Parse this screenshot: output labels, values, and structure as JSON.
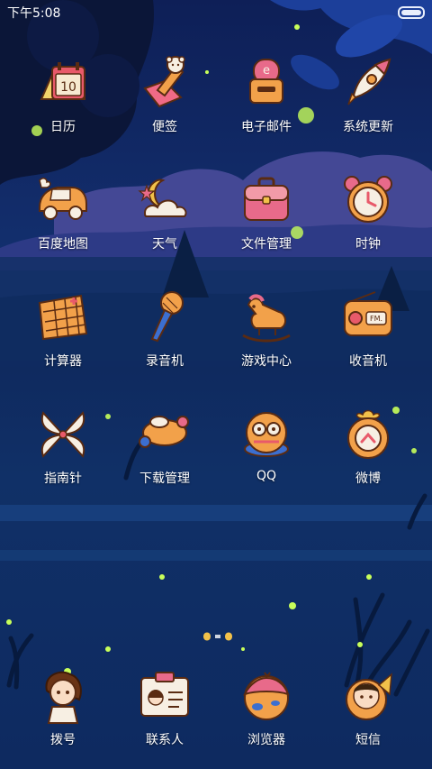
{
  "status_bar": {
    "time": "下午5:08"
  },
  "apps": [
    {
      "label": "日历",
      "icon": "calendar-icon",
      "text": "10"
    },
    {
      "label": "便签",
      "icon": "notes-icon"
    },
    {
      "label": "电子邮件",
      "icon": "mailbox-icon",
      "text": "e"
    },
    {
      "label": "系统更新",
      "icon": "rocket-icon"
    },
    {
      "label": "百度地图",
      "icon": "car-icon"
    },
    {
      "label": "天气",
      "icon": "weather-icon"
    },
    {
      "label": "文件管理",
      "icon": "briefcase-icon"
    },
    {
      "label": "时钟",
      "icon": "alarm-clock-icon"
    },
    {
      "label": "计算器",
      "icon": "calculator-icon"
    },
    {
      "label": "录音机",
      "icon": "microphone-icon"
    },
    {
      "label": "游戏中心",
      "icon": "rocking-horse-icon"
    },
    {
      "label": "收音机",
      "icon": "radio-icon",
      "text": "FM."
    },
    {
      "label": "指南针",
      "icon": "compass-icon"
    },
    {
      "label": "下载管理",
      "icon": "download-icon"
    },
    {
      "label": "QQ",
      "icon": "qq-icon"
    },
    {
      "label": "微博",
      "icon": "weibo-icon"
    }
  ],
  "dock": [
    {
      "label": "拨号",
      "icon": "dialer-icon"
    },
    {
      "label": "联系人",
      "icon": "contacts-icon"
    },
    {
      "label": "浏览器",
      "icon": "browser-icon"
    },
    {
      "label": "短信",
      "icon": "messages-icon"
    }
  ],
  "colors": {
    "accent_orange": "#f2a14a",
    "outline": "#5a2b12",
    "pink": "#e86a8a"
  }
}
